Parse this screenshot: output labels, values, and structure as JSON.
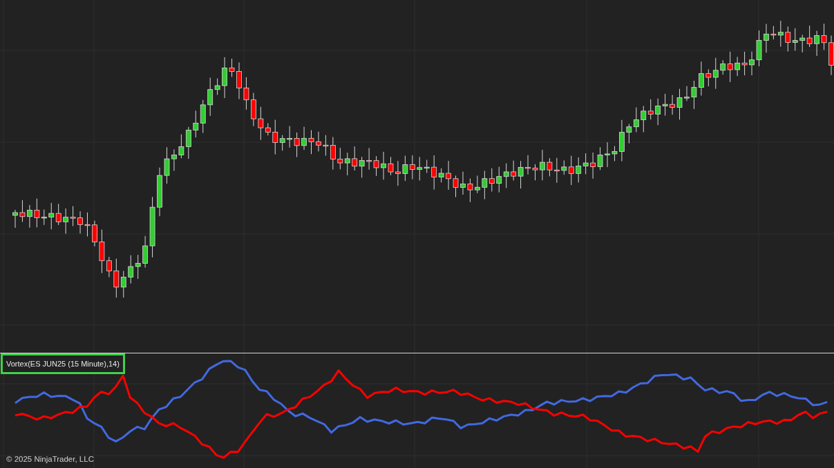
{
  "indicator_pane": {
    "label": "Vortex(ES JUN25 (15 Minute),14)"
  },
  "footer": {
    "copyright": "© 2025 NinjaTrader, LLC"
  }
}
